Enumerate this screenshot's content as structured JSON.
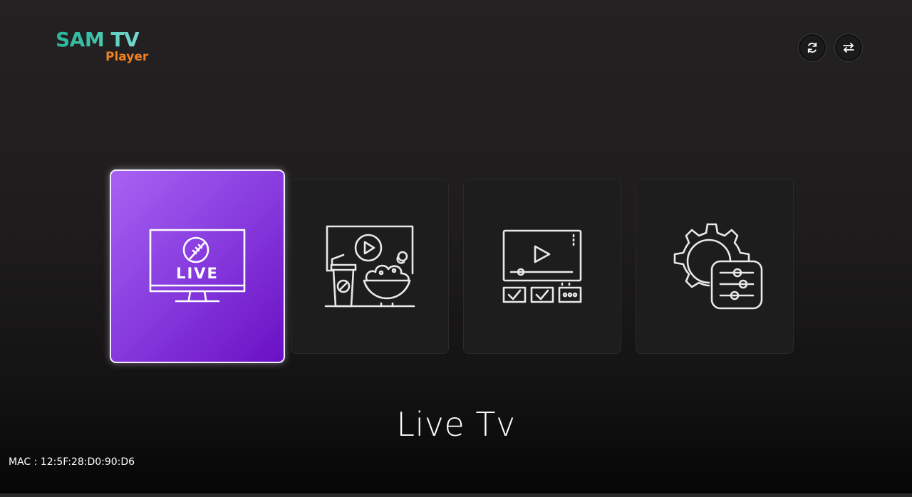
{
  "logo": {
    "brand": "SAM TV",
    "sub": "Player",
    "colors": {
      "brand": "#3cc3a6",
      "sub": "#f07f22"
    }
  },
  "header": {
    "buttons": [
      {
        "name": "refresh",
        "icon": "refresh-icon"
      },
      {
        "name": "switch",
        "icon": "swap-arrows-icon"
      }
    ]
  },
  "menu": {
    "tiles": [
      {
        "id": "live-tv",
        "icon": "live-tv-icon",
        "icon_text": "LIVE",
        "selected": true
      },
      {
        "id": "movies",
        "icon": "movie-theater-icon",
        "selected": false
      },
      {
        "id": "series",
        "icon": "video-player-icon",
        "selected": false
      },
      {
        "id": "settings",
        "icon": "settings-gear-icon",
        "selected": false
      }
    ],
    "selected_caption": "Live Tv",
    "colors": {
      "selected_start": "#a862f2",
      "selected_end": "#6a10c4",
      "tile_bg": "#1d1d1d"
    }
  },
  "footer": {
    "mac_label": "MAC : 12:5F:28:D0:90:D6"
  }
}
